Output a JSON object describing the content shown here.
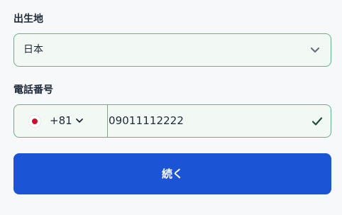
{
  "birthplace": {
    "label": "出生地",
    "selected": "日本",
    "icon": "chevron-down-icon"
  },
  "phone": {
    "label": "電話番号",
    "country_flag": "japan-flag-icon",
    "dial_code": "+81",
    "number": "09011112222",
    "valid_icon": "check-icon"
  },
  "continue_label": "続く",
  "colors": {
    "border": "#5fb48a",
    "field_bg": "#f2f8f4",
    "button": "#1c54d6",
    "check": "#1f4e3d"
  }
}
